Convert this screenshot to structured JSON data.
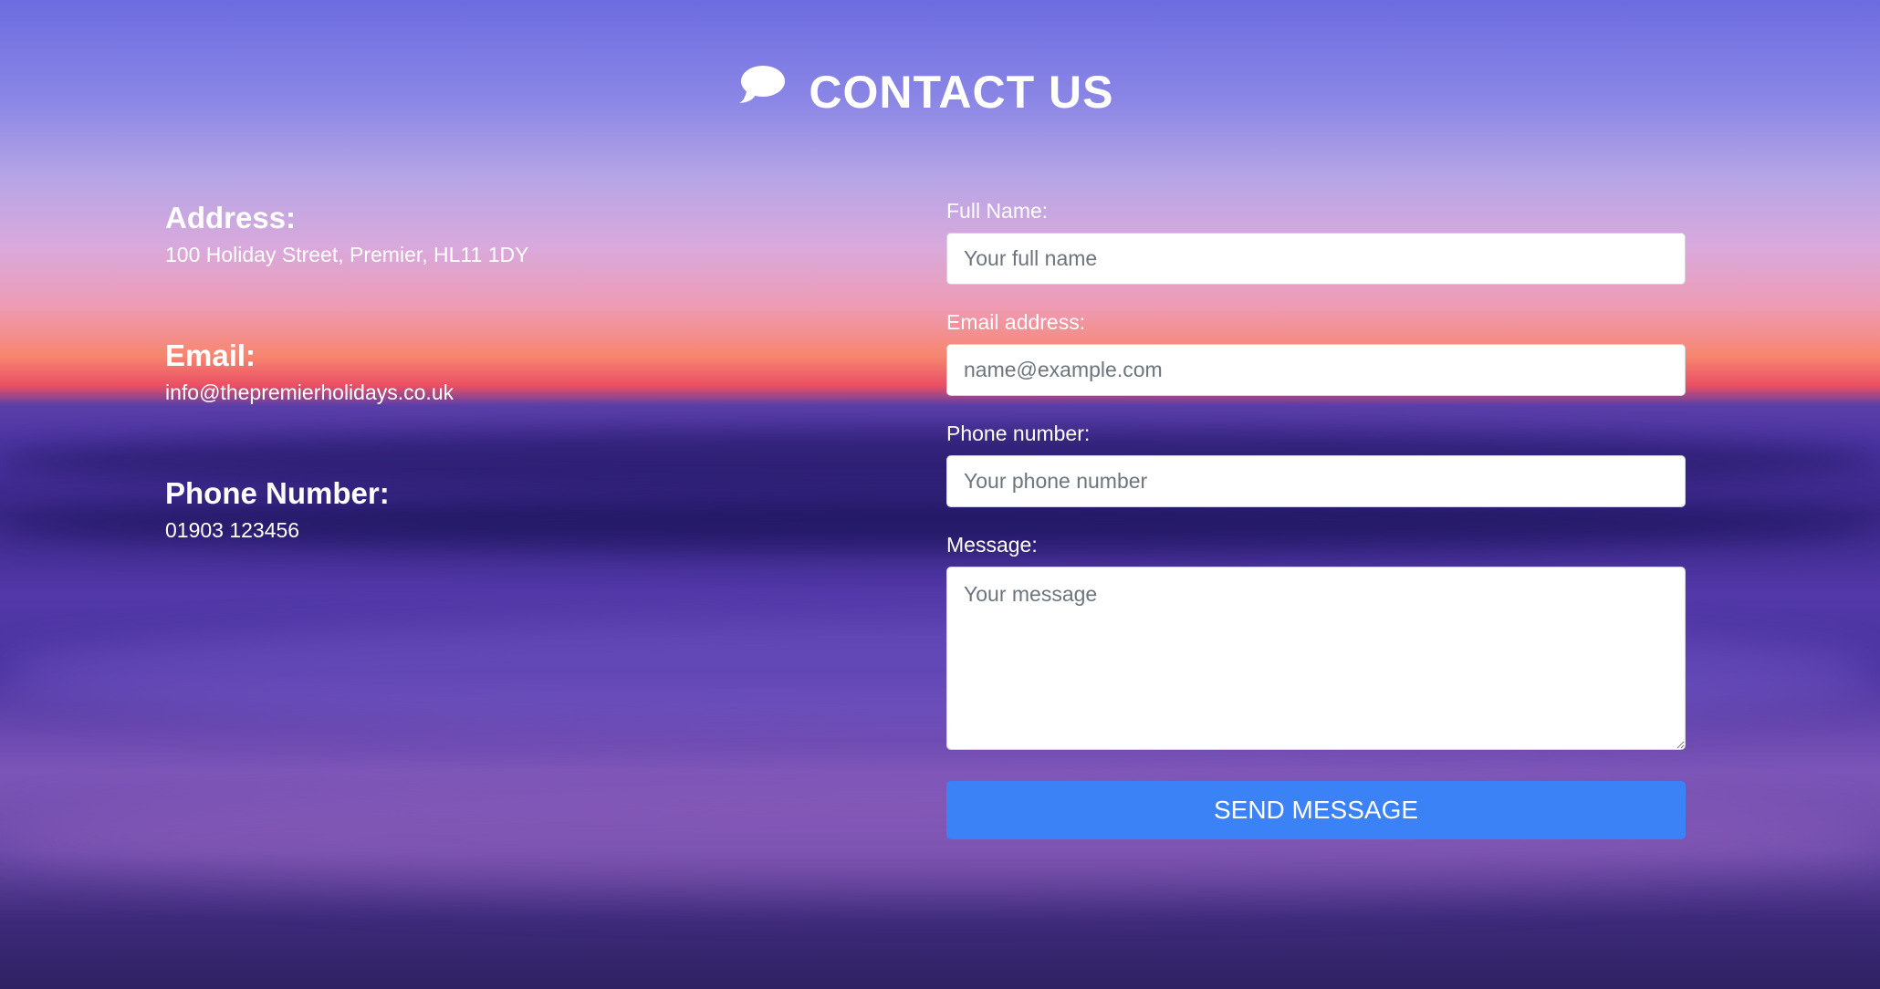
{
  "page": {
    "title": "CONTACT US",
    "title_icon": "chat-bubble-icon"
  },
  "contact_info": {
    "address": {
      "label": "Address:",
      "value": "100 Holiday Street, Premier, HL11 1DY"
    },
    "email": {
      "label": "Email:",
      "value": "info@thepremierholidays.co.uk"
    },
    "phone": {
      "label": "Phone Number:",
      "value": "01903 123456"
    }
  },
  "form": {
    "full_name": {
      "label": "Full Name:",
      "placeholder": "Your full name",
      "value": ""
    },
    "email": {
      "label": "Email address:",
      "placeholder": "name@example.com",
      "value": ""
    },
    "phone": {
      "label": "Phone number:",
      "placeholder": "Your phone number",
      "value": ""
    },
    "message": {
      "label": "Message:",
      "placeholder": "Your message",
      "value": ""
    },
    "submit_label": "Send Message"
  },
  "colors": {
    "button": "#3b82f6",
    "text": "#ffffff"
  }
}
